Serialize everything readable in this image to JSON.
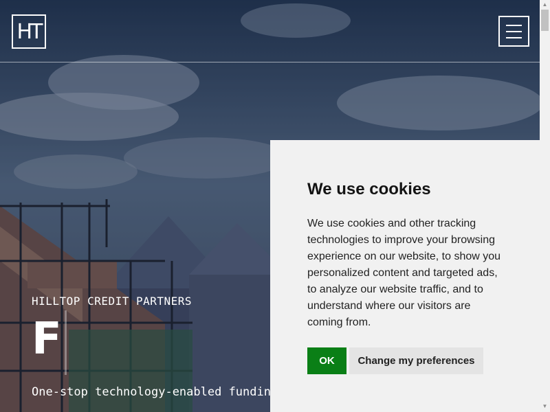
{
  "header": {
    "logo_text": "HT",
    "menu_icon": "hamburger-icon"
  },
  "hero": {
    "brand": "HILLTOP CREDIT PARTNERS",
    "big_letter": "F",
    "tagline": "One-stop technology-enabled funding"
  },
  "cookie_banner": {
    "title": "We use cookies",
    "body": "We use cookies and other tracking technologies to improve your browsing experience on our website, to show you personalized content and targeted ads, to analyze our website traffic, and to understand where our visitors are coming from.",
    "ok_label": "OK",
    "preferences_label": "Change my preferences"
  },
  "colors": {
    "ok_button": "#0a7f16",
    "panel_bg": "#f1f1f1",
    "hero_overlay": "#2b3446"
  }
}
